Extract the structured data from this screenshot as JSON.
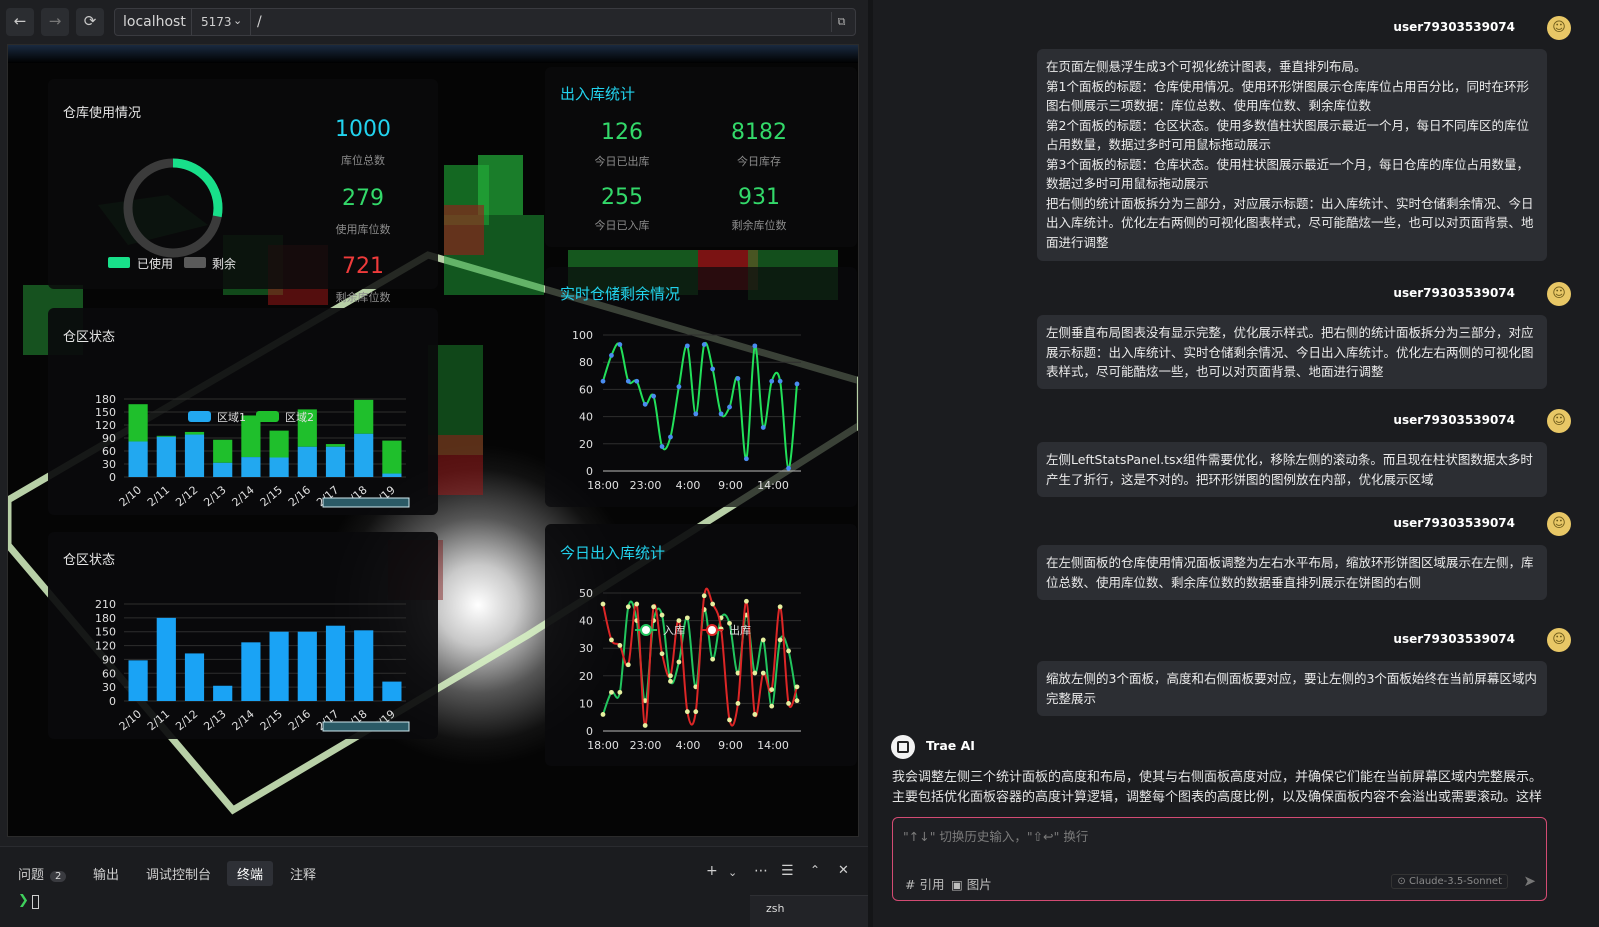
{
  "browser": {
    "host": "localhost",
    "port": "5173",
    "path": "/"
  },
  "dashboard": {
    "warehouse_usage": {
      "title": "仓库使用情况",
      "legend_used": "已使用",
      "legend_remaining": "剩余",
      "used_fraction": 0.279,
      "total": "1000",
      "total_label": "库位总数",
      "used": "279",
      "used_label": "使用库位数",
      "remaining": "721",
      "remaining_label": "剩余库位数"
    },
    "inout_stats": {
      "title": "出入库统计",
      "out_today": "126",
      "out_today_label": "今日已出库",
      "stock_today": "8182",
      "stock_today_label": "今日库存",
      "in_today": "255",
      "in_today_label": "今日已入库",
      "remaining": "931",
      "remaining_label": "剩余库位数"
    },
    "zone_status_title": "仓区状态",
    "warehouse_status_title": "仓区状态",
    "realtime_title": "实时仓储剩余情况",
    "today_inout_title": "今日出入库统计"
  },
  "chart_data": [
    {
      "type": "bar",
      "title": "仓区状态",
      "categories": [
        "2/10",
        "2/11",
        "2/12",
        "2/13",
        "2/14",
        "2/15",
        "2/16",
        "2/17",
        "2/18",
        "2/19"
      ],
      "series": [
        {
          "name": "区域1",
          "values": [
            82,
            93,
            98,
            33,
            46,
            45,
            70,
            70,
            100,
            8
          ],
          "color": "#22a8f0"
        },
        {
          "name": "区域2",
          "values": [
            86,
            2,
            6,
            53,
            96,
            62,
            86,
            6,
            78,
            76
          ],
          "color": "#1fbf2c"
        }
      ],
      "stacked": true,
      "yticks": [
        0,
        30,
        60,
        90,
        120,
        150,
        180
      ],
      "ylim": [
        0,
        180
      ]
    },
    {
      "type": "bar",
      "title": "仓区状态",
      "categories": [
        "2/10",
        "2/11",
        "2/12",
        "2/13",
        "2/14",
        "2/15",
        "2/16",
        "2/17",
        "2/18",
        "2/19"
      ],
      "values": [
        88,
        180,
        103,
        33,
        127,
        150,
        150,
        163,
        153,
        42
      ],
      "yticks": [
        0,
        30,
        60,
        90,
        120,
        150,
        180,
        210
      ],
      "ylim": [
        0,
        210
      ]
    },
    {
      "type": "line",
      "title": "实时仓储剩余情况",
      "xticks": [
        "18:00",
        "23:00",
        "4:00",
        "9:00",
        "14:00"
      ],
      "yticks": [
        0,
        20,
        40,
        60,
        80,
        100
      ],
      "ylim": [
        0,
        100
      ],
      "values": [
        66,
        85,
        93,
        66,
        66,
        49,
        55,
        18,
        25,
        62,
        92,
        42,
        93,
        75,
        42,
        47,
        68,
        9,
        92,
        32,
        66,
        66,
        2,
        64
      ]
    },
    {
      "type": "line",
      "title": "今日出入库统计",
      "xticks": [
        "18:00",
        "23:00",
        "4:00",
        "9:00",
        "14:00"
      ],
      "yticks": [
        0,
        10,
        20,
        30,
        40,
        50
      ],
      "ylim": [
        0,
        50
      ],
      "series": [
        {
          "name": "入库",
          "color": "#22c55e",
          "values": [
            6,
            14,
            14,
            45,
            40,
            11,
            40,
            42,
            18,
            25,
            41,
            16,
            44,
            26,
            41,
            39,
            21,
            42,
            21,
            33,
            9,
            33,
            29,
            11
          ]
        },
        {
          "name": "出库",
          "color": "#dc2626",
          "values": [
            46,
            33,
            31,
            24,
            46,
            2,
            45,
            28,
            20,
            40,
            7,
            7,
            49,
            46,
            37,
            4,
            10,
            47,
            6,
            21,
            15,
            45,
            10,
            16
          ]
        }
      ]
    }
  ],
  "bottom_panel": {
    "tabs": [
      {
        "label": "问题",
        "badge": "2"
      },
      {
        "label": "输出"
      },
      {
        "label": "调试控制台"
      },
      {
        "label": "终端"
      },
      {
        "label": "注释"
      }
    ],
    "terminal_prompt": "❯",
    "terminal_tab": "zsh"
  },
  "chat": {
    "messages": [
      {
        "user": "user79303539074",
        "lines": [
          " 在页面左侧悬浮生成3个可视化统计图表，垂直排列布局。",
          "  第1个面板的标题：仓库使用情况。使用环形饼图展示仓库库位占用百分比，同时在环形图右侧展示三项数据：库位总数、使用库位数、剩余库位数",
          "第2个面板的标题：仓区状态。使用多数值柱状图展示最近一个月，每日不同库区的库位占用数量，数据过多时可用鼠标拖动展示",
          "第3个面板的标题：仓库状态。使用柱状图展示最近一个月，每日仓库的库位占用数量，数据过多时可用鼠标拖动展示",
          "把右侧的统计面板拆分为三部分，对应展示标题：出入库统计、实时仓储剩余情况、今日出入库统计。优化左右两侧的可视化图表样式，尽可能酷炫一些，也可以对页面背景、地面进行调整"
        ]
      },
      {
        "user": "user79303539074",
        "lines": [
          "左侧垂直布局图表没有显示完整，优化展示样式。把右侧的统计面板拆分为三部分，对应展示标题：出入库统计、实时仓储剩余情况、今日出入库统计。优化左右两侧的可视化图表样式，尽可能酷炫一些，也可以对页面背景、地面进行调整"
        ]
      },
      {
        "user": "user79303539074",
        "lines": [
          "左侧LeftStatsPanel.tsx组件需要优化，移除左侧的滚动条。而且现在柱状图数据太多时产生了折行，这是不对的。把环形饼图的图例放在内部，优化展示区域"
        ]
      },
      {
        "user": "user79303539074",
        "lines": [
          "在左侧面板的仓库使用情况面板调整为左右水平布局，缩放环形饼图区域展示在左侧，库位总数、使用库位数、剩余库位数的数据垂直排列展示在饼图的右侧"
        ]
      },
      {
        "user": "user79303539074",
        "lines": [
          "缩放左侧的3个面板，高度和右侧面板要对应，要让左侧的3个面板始终在当前屏幕区域内完整展示"
        ]
      }
    ],
    "assistant_name": "Trae AI",
    "assistant_text": "我会调整左侧三个统计面板的高度和布局，使其与右侧面板高度对应，并确保它们能在当前屏幕区域内完整展示。主要包括优化面板容器的高度计算逻辑，调整每个图表的高度比例，以及确保面板内容不会溢出或需要滚动。这样可以",
    "input_placeholder": "\"↑↓\" 切换历史输入，\"⇧↩\" 换行",
    "ref_label": "# 引用",
    "image_label": "图片",
    "model": "Claude-3.5-Sonnet"
  }
}
